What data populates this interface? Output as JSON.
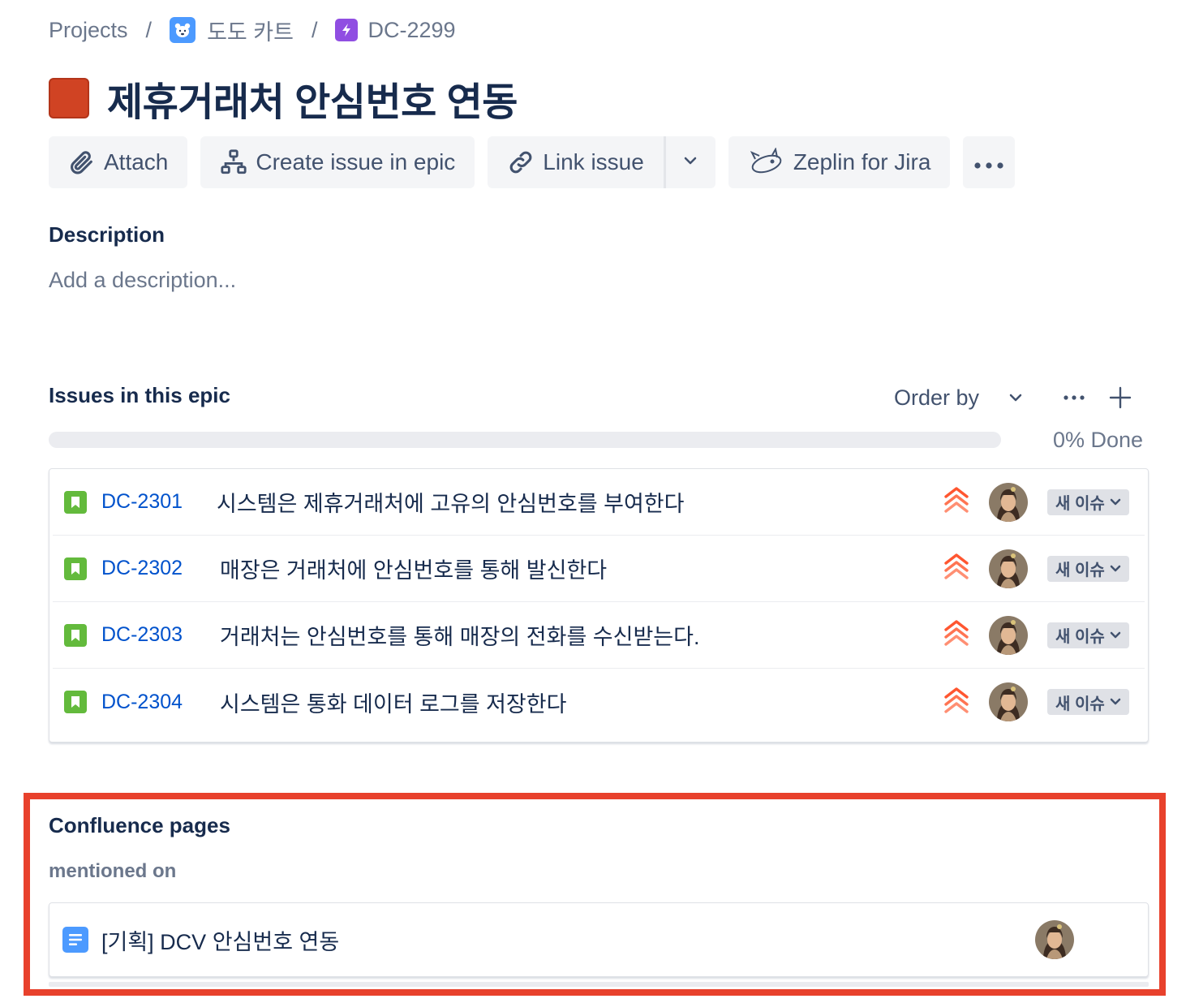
{
  "breadcrumb": {
    "projects_label": "Projects",
    "project_name": "도도 카트",
    "issue_key": "DC-2299",
    "separator": "/"
  },
  "epic": {
    "title": "제휴거래처 안심번호 연동",
    "color": "#d04323"
  },
  "toolbar": {
    "attach_label": "Attach",
    "create_issue_label": "Create issue in epic",
    "link_issue_label": "Link issue",
    "zeplin_label": "Zeplin for Jira"
  },
  "description": {
    "heading": "Description",
    "placeholder": "Add a description..."
  },
  "issues_in_epic": {
    "heading": "Issues in this epic",
    "order_by_label": "Order by",
    "progress_percent": 0,
    "done_label": "0% Done",
    "issues": [
      {
        "key": "DC-2301",
        "summary": "시스템은 제휴거래처에 고유의 안심번호를 부여한다",
        "status": "새 이슈",
        "priority": "highest-priority-icon",
        "type": "story-icon"
      },
      {
        "key": "DC-2302",
        "summary": "매장은 거래처에 안심번호를 통해 발신한다",
        "status": "새 이슈",
        "priority": "highest-priority-icon",
        "type": "story-icon"
      },
      {
        "key": "DC-2303",
        "summary": "거래처는 안심번호를 통해 매장의 전화를 수신받는다.",
        "status": "새 이슈",
        "priority": "highest-priority-icon",
        "type": "story-icon"
      },
      {
        "key": "DC-2304",
        "summary": "시스템은 통화 데이터 로그를 저장한다",
        "status": "새 이슈",
        "priority": "highest-priority-icon",
        "type": "story-icon"
      }
    ]
  },
  "confluence": {
    "heading": "Confluence pages",
    "subheading": "mentioned on",
    "pages": [
      {
        "title": "[기획] DCV 안심번호 연동"
      }
    ]
  },
  "colors": {
    "link_blue": "#0052cc",
    "story_green": "#63ba3c",
    "priority_orange": "#ff7452",
    "highlight_red": "#e8412c"
  }
}
